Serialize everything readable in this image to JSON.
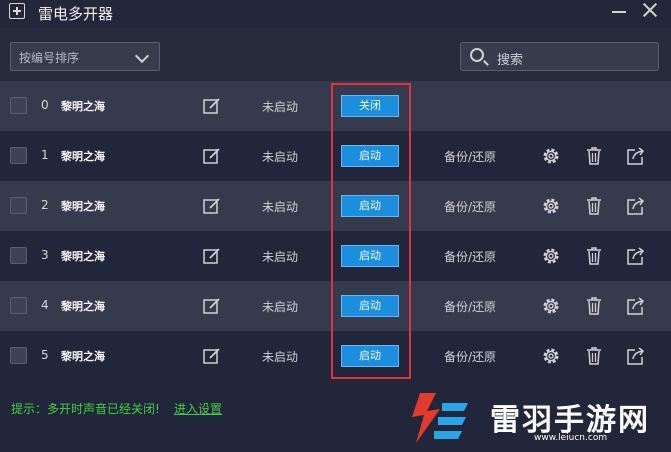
{
  "window": {
    "title": "雷电多开器"
  },
  "toolbar": {
    "sort_label": "按编号排序",
    "search_placeholder": "搜索"
  },
  "rows": [
    {
      "index": "0",
      "name": "黎明之海",
      "status": "未启动",
      "action": "关闭",
      "backup": ""
    },
    {
      "index": "1",
      "name": "黎明之海",
      "status": "未启动",
      "action": "启动",
      "backup": "备份/还原"
    },
    {
      "index": "2",
      "name": "黎明之海",
      "status": "未启动",
      "action": "启动",
      "backup": "备份/还原"
    },
    {
      "index": "3",
      "name": "黎明之海",
      "status": "未启动",
      "action": "启动",
      "backup": "备份/还原"
    },
    {
      "index": "4",
      "name": "黎明之海",
      "status": "未启动",
      "action": "启动",
      "backup": "备份/还原"
    },
    {
      "index": "5",
      "name": "黎明之海",
      "status": "未启动",
      "action": "启动",
      "backup": "备份/还原"
    }
  ],
  "footer": {
    "tip": "提示：多开时声音已经关闭!",
    "link": "进入设置"
  },
  "watermark": {
    "name": "雷羽手游网",
    "url": "www.leiucn.com"
  },
  "colors": {
    "accent": "#1a8fe0",
    "highlight": "#e0343c",
    "tip": "#3fd13f"
  }
}
